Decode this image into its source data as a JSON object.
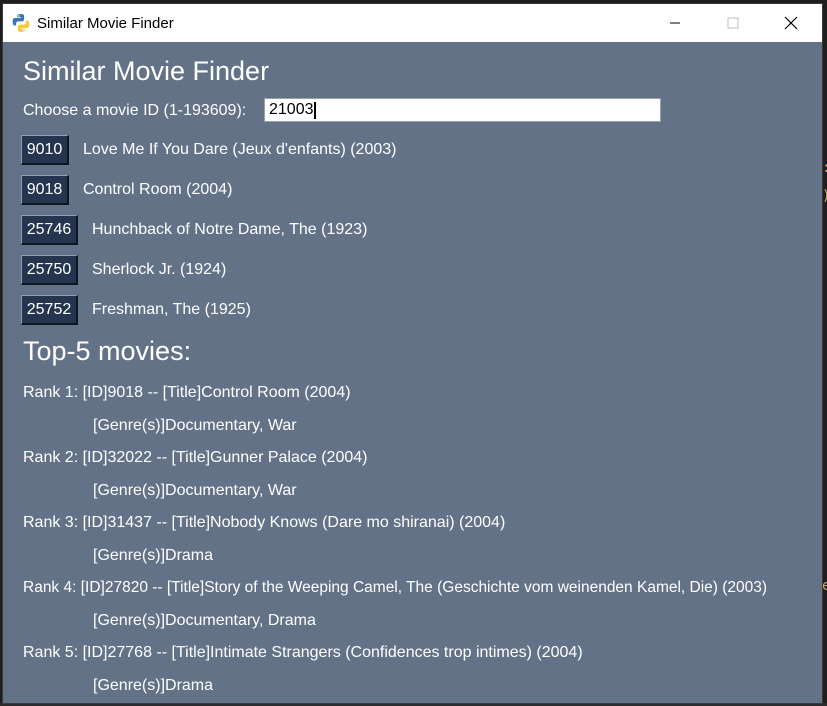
{
  "window": {
    "title": "Similar Movie Finder"
  },
  "app": {
    "heading": "Similar Movie Finder",
    "prompt_label": "Choose a movie ID (1-193609):",
    "input_value": "21003"
  },
  "suggestions": [
    {
      "id": "9010",
      "title": "Love Me If You Dare (Jeux d'enfants) (2003)"
    },
    {
      "id": "9018",
      "title": "Control Room (2004)"
    },
    {
      "id": "25746",
      "title": "Hunchback of Notre Dame, The (1923)"
    },
    {
      "id": "25750",
      "title": "Sherlock Jr. (1924)"
    },
    {
      "id": "25752",
      "title": "Freshman, The (1925)"
    }
  ],
  "results": {
    "heading": "Top-5 movies:",
    "items": [
      {
        "line": "Rank 1: [ID]9018 -- [Title]Control Room (2004)",
        "genres": "[Genre(s)]Documentary, War"
      },
      {
        "line": "Rank 2: [ID]32022 -- [Title]Gunner Palace (2004)",
        "genres": "[Genre(s)]Documentary, War"
      },
      {
        "line": "Rank 3: [ID]31437 -- [Title]Nobody Knows (Dare mo shiranai) (2004)",
        "genres": "[Genre(s)]Drama"
      },
      {
        "line": "Rank 4: [ID]27820 -- [Title]Story of the Weeping Camel, The (Geschichte vom weinenden Kamel, Die) (2003)",
        "genres": "[Genre(s)]Documentary, Drama"
      },
      {
        "line": "Rank 5: [ID]27768 -- [Title]Intimate Strangers (Confidences trop intimes) (2004)",
        "genres": "[Genre(s)]Drama"
      }
    ]
  },
  "icons": {
    "app": "python-icon",
    "minimize": "minimize-icon",
    "maximize": "maximize-icon",
    "close": "close-icon"
  },
  "colors": {
    "window_bg": "#637287",
    "button_bg": "#25354f",
    "text": "#ffffff"
  }
}
